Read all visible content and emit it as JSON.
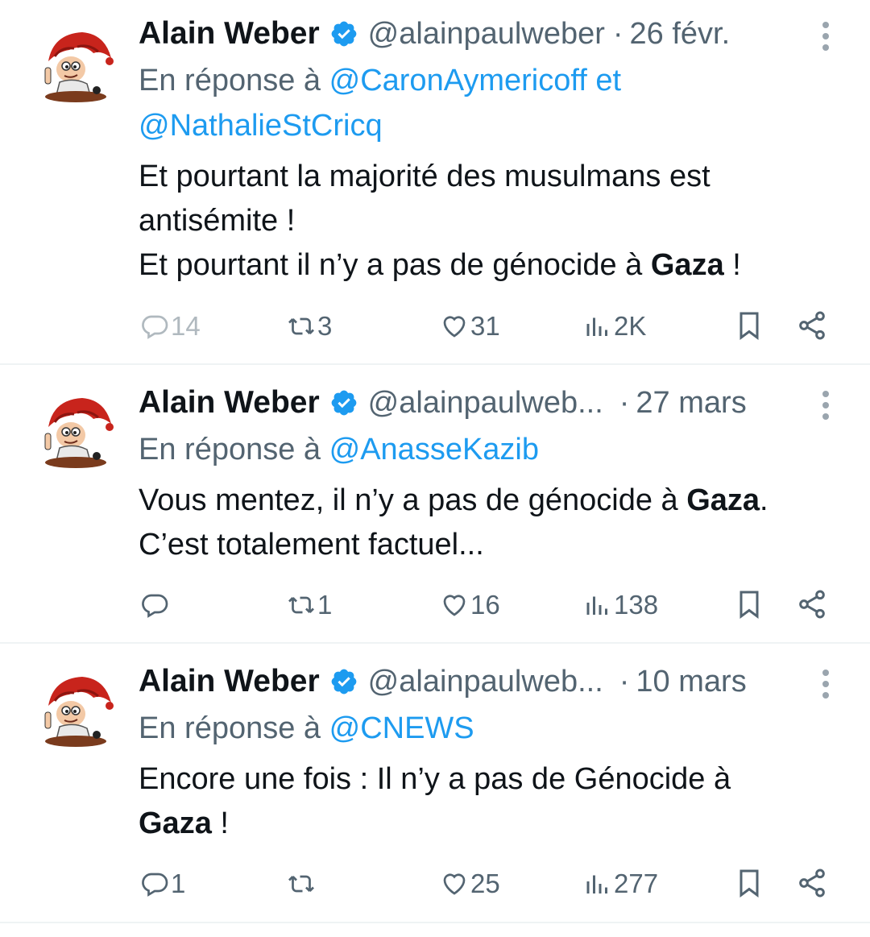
{
  "tweets": [
    {
      "author": "Alain Weber",
      "handle": "@alainpaulweber",
      "separator": "·",
      "date": "26 févr.",
      "reply_prefix": "En réponse à",
      "mentions": [
        "@CaronAymericoff",
        "@NathalieStCricq"
      ],
      "mention_join": "et",
      "body_lines": [
        {
          "parts": [
            {
              "text": "Et pourtant la majorité des musulmans est",
              "bold": false
            }
          ]
        },
        {
          "parts": [
            {
              "text": "antisémite !",
              "bold": false
            }
          ]
        },
        {
          "parts": [
            {
              "text": "Et pourtant il n’y a pas de génocide à ",
              "bold": false
            },
            {
              "text": "Gaza",
              "bold": true
            },
            {
              "text": " !",
              "bold": false
            }
          ]
        }
      ],
      "stats": {
        "replies": "14",
        "reposts": "3",
        "likes": "31",
        "views": "2K"
      }
    },
    {
      "author": "Alain Weber",
      "handle": "@alainpaulweb...",
      "separator": "·",
      "date": "27 mars",
      "reply_prefix": "En réponse à",
      "mentions": [
        "@AnasseKazib"
      ],
      "mention_join": "",
      "body_lines": [
        {
          "parts": [
            {
              "text": "Vous mentez, il n’y a pas de génocide à ",
              "bold": false
            },
            {
              "text": "Gaza",
              "bold": true
            },
            {
              "text": ".",
              "bold": false
            }
          ]
        },
        {
          "parts": [
            {
              "text": "C’est totalement factuel...",
              "bold": false
            }
          ]
        }
      ],
      "stats": {
        "replies": "",
        "reposts": "1",
        "likes": "16",
        "views": "138"
      }
    },
    {
      "author": "Alain Weber",
      "handle": "@alainpaulweb...",
      "separator": "·",
      "date": "10 mars",
      "reply_prefix": "En réponse à",
      "mentions": [
        "@CNEWS"
      ],
      "mention_join": "",
      "body_lines": [
        {
          "parts": [
            {
              "text": "Encore une fois : Il n’y a pas de Génocide à",
              "bold": false
            }
          ]
        },
        {
          "parts": [
            {
              "text": "Gaza",
              "bold": true
            },
            {
              "text": " !",
              "bold": false
            }
          ]
        }
      ],
      "stats": {
        "replies": "1",
        "reposts": "",
        "likes": "25",
        "views": "277"
      }
    }
  ],
  "colors": {
    "text": "#0f1419",
    "muted": "#536471",
    "link": "#1d9bf0",
    "verified": "#1d9bf0",
    "divider": "#eff3f4"
  }
}
